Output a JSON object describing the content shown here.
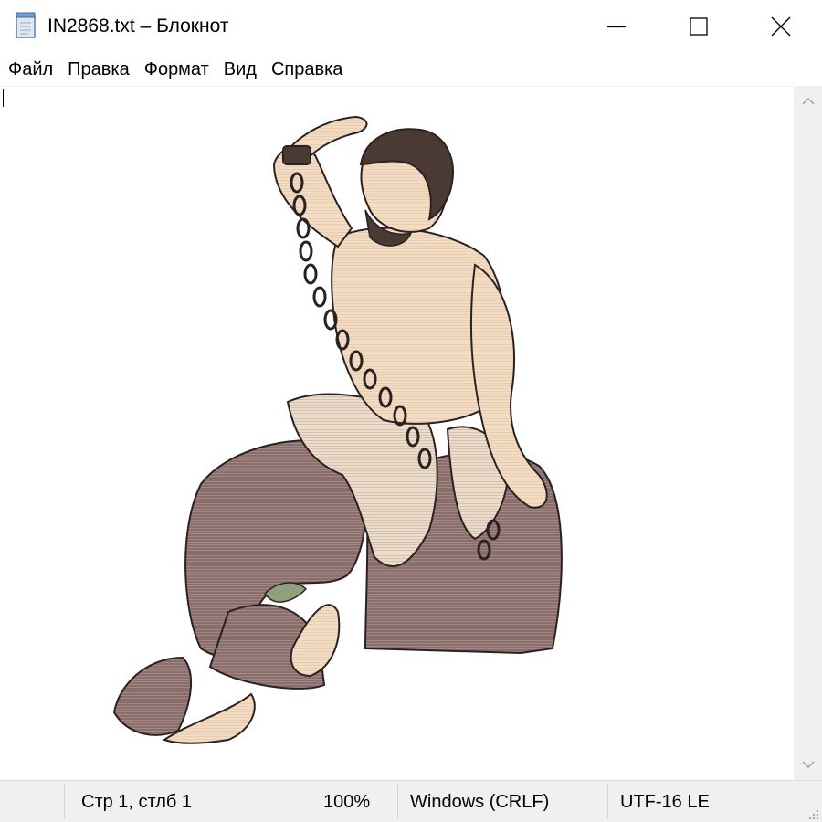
{
  "window": {
    "title": "IN2868.txt – Блокнот",
    "icon": "notepad-icon"
  },
  "controls": {
    "minimize_icon": "minimize-icon",
    "maximize_icon": "maximize-icon",
    "close_icon": "close-icon"
  },
  "menu": {
    "items": [
      "Файл",
      "Правка",
      "Формат",
      "Вид",
      "Справка"
    ]
  },
  "statusbar": {
    "position": "Стр 1, стлб 1",
    "zoom": "100%",
    "line_endings": "Windows (CRLF)",
    "encoding": "UTF-16 LE"
  },
  "content": {
    "art_colors": {
      "skin": "#f3dcc4",
      "cloth": "#8a6e6c",
      "hair": "#4a3a33",
      "outline": "#2a2222",
      "leaf": "#8fa07a"
    }
  }
}
